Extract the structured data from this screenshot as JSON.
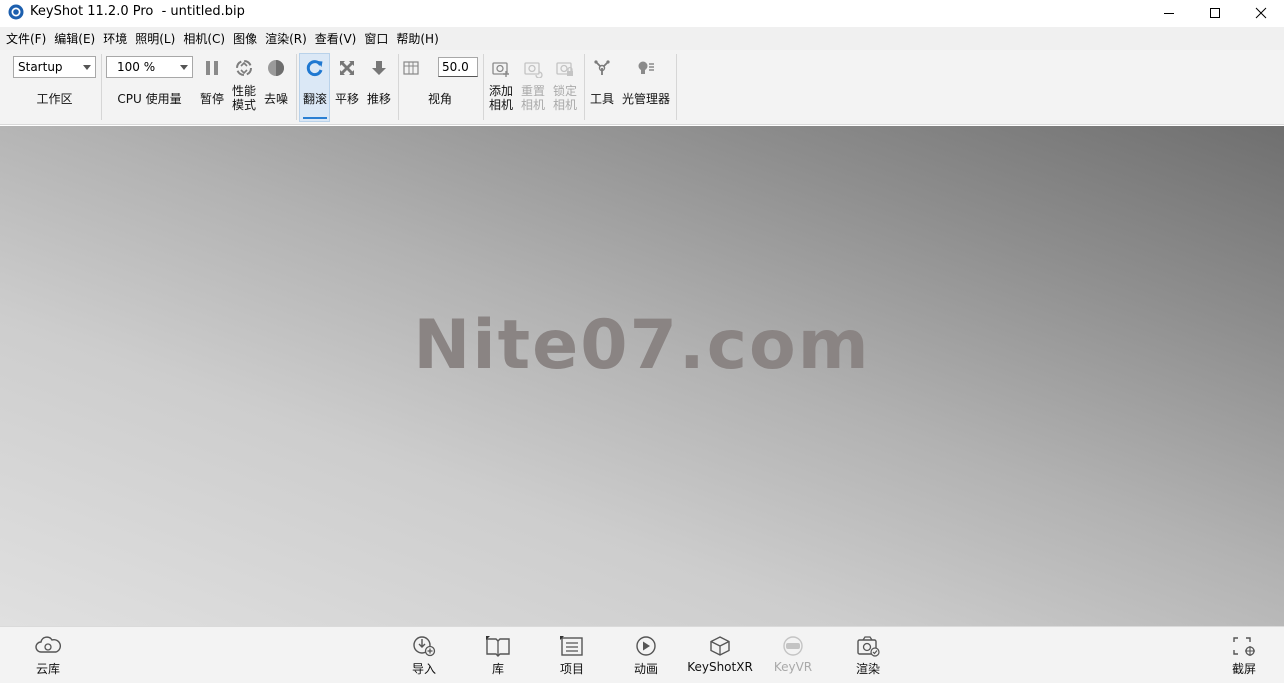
{
  "window": {
    "title": "KeyShot 11.2.0 Pro  - untitled.bip",
    "controls": [
      "minimize-icon",
      "maximize-icon",
      "close-icon"
    ]
  },
  "menu": [
    "文件(F)",
    "编辑(E)",
    "环境",
    "照明(L)",
    "相机(C)",
    "图像",
    "渲染(R)",
    "查看(V)",
    "窗口",
    "帮助(H)"
  ],
  "toolbar": {
    "workspace": {
      "value": "Startup",
      "label": "工作区"
    },
    "cpu": {
      "value": "100 %",
      "label": "CPU 使用量"
    },
    "pause_label": "暂停",
    "performance_label": "性能\n模式",
    "denoise_label": "去噪",
    "tumble_label": "翻滚",
    "pan_label": "平移",
    "dolly_label": "推移",
    "fov": {
      "value": "50.0",
      "label": "视角"
    },
    "add_camera_label": "添加\n相机",
    "reset_camera_label": "重置\n相机",
    "lock_camera_label": "锁定\n相机",
    "tools_label": "工具",
    "light_manager_label": "光管理器",
    "active_tool": "tumble",
    "accent_color": "#2a7fd3"
  },
  "viewport": {
    "watermark": "Nite07.com"
  },
  "bottombar": {
    "cloud_library": "云库",
    "import": "导入",
    "library": "库",
    "project": "项目",
    "animation": "动画",
    "keyshotxr": "KeyShotXR",
    "keyvr": "KeyVR",
    "render": "渲染",
    "screenshot": "截屏"
  }
}
